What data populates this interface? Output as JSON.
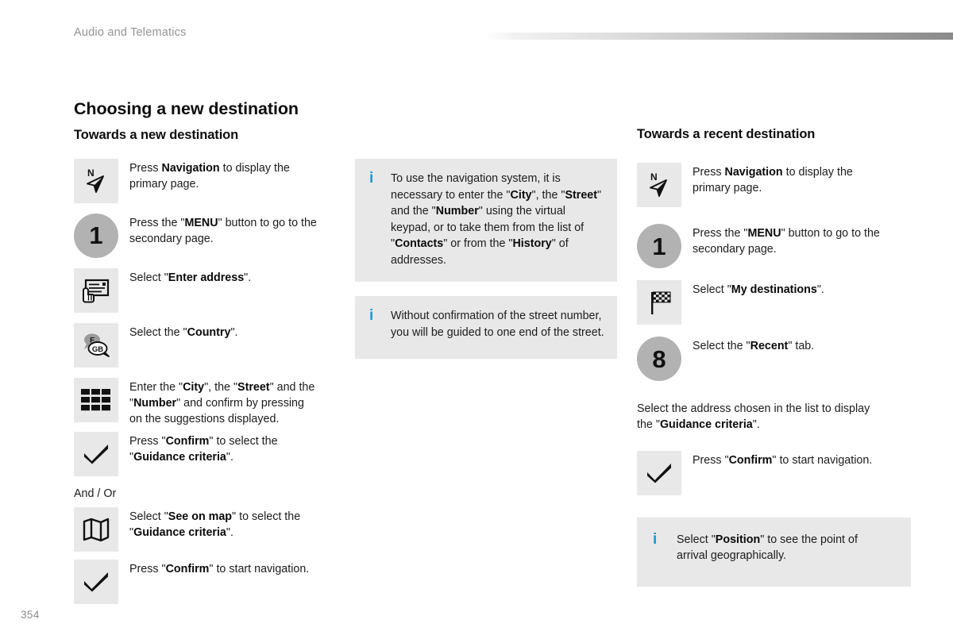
{
  "header": {
    "title": "Audio and Telematics",
    "rule": "gradient-rule"
  },
  "page_number": "354",
  "colors": {
    "icon_box_bg": "#e8e8e8",
    "circle_bg": "#b2b2b2",
    "info_accent": "#1a9ad6",
    "header_text": "#949494",
    "body_text": "#1c1c1c"
  },
  "left_column": {
    "section_title": "Choosing a new destination",
    "sub_title": "Towards a new destination",
    "and_or_label": "And / Or",
    "steps": [
      {
        "icon": "navigation-compass-icon",
        "icon_type": "box",
        "text_html": "Press <b>Navigation</b> to display the primary page."
      },
      {
        "icon": "step-number-1",
        "icon_type": "circle",
        "number": "1",
        "text_html": "Press the \"<b>MENU</b>\" button to go to the secondary page."
      },
      {
        "icon": "enter-address-card-icon",
        "icon_type": "box",
        "text_html": "Select \"<b>Enter address</b>\"."
      },
      {
        "icon": "country-speech-bubbles-icon",
        "icon_type": "box",
        "icon_labels": [
          "F",
          "GB"
        ],
        "text_html": "Select the \"<b>Country</b>\"."
      },
      {
        "icon": "virtual-keypad-icon",
        "icon_type": "box",
        "text_html": "Enter the \"<b>City</b>\", the \"<b>Street</b>\" and the \"<b>Number</b>\" and confirm by pressing on the suggestions displayed."
      },
      {
        "icon": "confirm-checkmark-icon",
        "icon_type": "box",
        "text_html": "Press \"<b>Confirm</b>\" to select the \"<b>Guidance criteria</b>\"."
      },
      {
        "icon": "see-on-map-icon",
        "icon_type": "box",
        "text_html": "Select \"<b>See on map</b>\" to select the \"<b>Guidance criteria</b>\"."
      },
      {
        "icon": "confirm-checkmark-icon",
        "icon_type": "box",
        "text_html": "Press \"<b>Confirm</b>\" to start navigation."
      }
    ]
  },
  "middle_column": {
    "info_boxes": [
      {
        "icon": "info-icon",
        "glyph": "i",
        "text_html": "To use the navigation system, it is necessary to enter the \"<b>City</b>\", the \"<b>Street</b>\" and the \"<b>Number</b>\" using the virtual keypad, or to take them from the list of \"<b>Contacts</b>\" or from the \"<b>History</b>\" of addresses."
      },
      {
        "icon": "info-icon",
        "glyph": "i",
        "text_html": "Without confirmation of the street number, you will be guided to one end of the street."
      }
    ]
  },
  "right_column": {
    "sub_title": "Towards a recent destination",
    "note_html": "Select the address chosen in the list to display the \"<b>Guidance criteria</b>\".",
    "steps": [
      {
        "icon": "navigation-compass-icon",
        "icon_type": "box",
        "text_html": "Press <b>Navigation</b> to display the primary page."
      },
      {
        "icon": "step-number-1",
        "icon_type": "circle",
        "number": "1",
        "text_html": "Press the \"<b>MENU</b>\" button to go to the secondary page."
      },
      {
        "icon": "my-destinations-flag-icon",
        "icon_type": "box",
        "text_html": "Select \"<b>My destinations</b>\"."
      },
      {
        "icon": "step-number-8",
        "icon_type": "circle",
        "number": "8",
        "text_html": "Select the \"<b>Recent</b>\" tab."
      },
      {
        "icon": "confirm-checkmark-icon",
        "icon_type": "box",
        "text_html": "Press \"<b>Confirm</b>\" to start navigation."
      }
    ],
    "info_boxes": [
      {
        "icon": "info-icon",
        "glyph": "i",
        "text_html": "Select \"<b>Position</b>\" to see the point of arrival geographically."
      }
    ]
  }
}
